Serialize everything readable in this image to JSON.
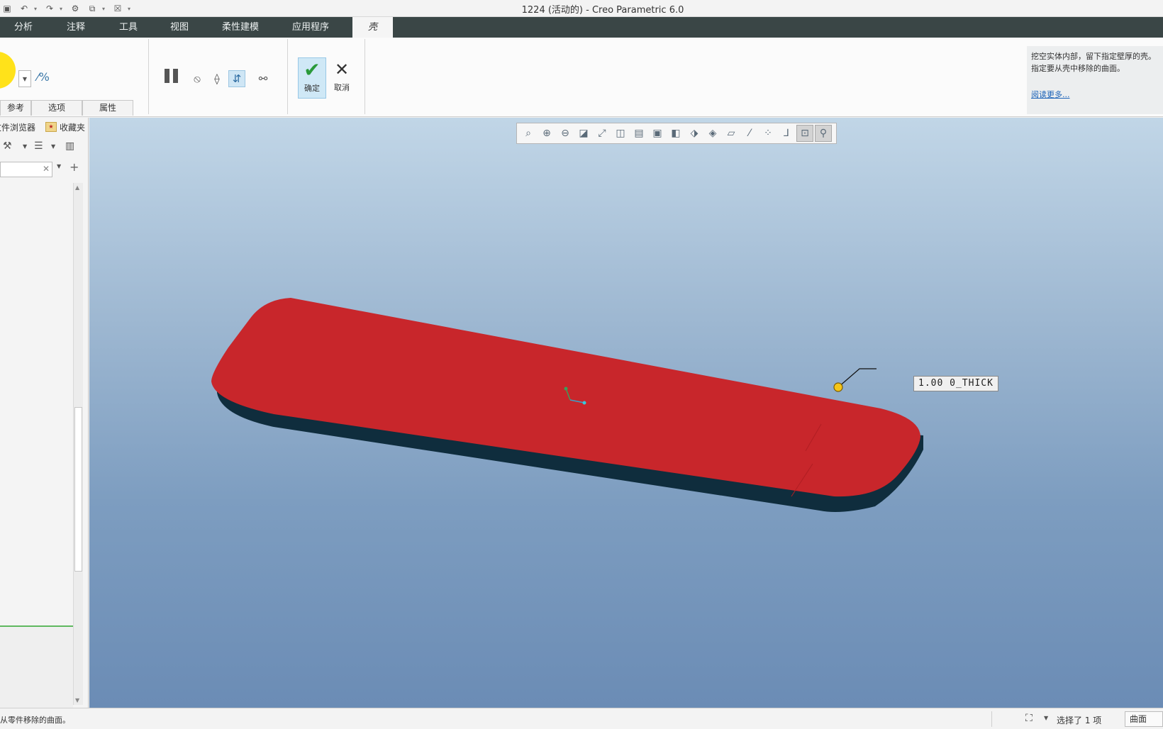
{
  "window": {
    "title": "1224 (活动的) - Creo Parametric 6.0"
  },
  "quick_access": {
    "icons": [
      "save-icon",
      "undo-icon",
      "redo-icon",
      "regenerate-icon",
      "window-icon",
      "close-window-icon",
      "customize-icon"
    ]
  },
  "menu": {
    "tabs": [
      {
        "label": "分析"
      },
      {
        "label": "注释"
      },
      {
        "label": "工具"
      },
      {
        "label": "视图"
      },
      {
        "label": "柔性建模"
      },
      {
        "label": "应用程序"
      },
      {
        "label": "壳"
      }
    ],
    "active": "壳"
  },
  "ribbon": {
    "subtabs": [
      {
        "label": "参考"
      },
      {
        "label": "选项"
      },
      {
        "label": "属性"
      }
    ],
    "ok_label": "确定",
    "cancel_label": "取消",
    "help": {
      "line1": "挖空实体内部，留下指定壁厚的壳。",
      "line2": "指定要从壳中移除的曲面。",
      "link": "阅读更多..."
    }
  },
  "left_panel": {
    "tabs": [
      {
        "label": "文件浏览器"
      },
      {
        "label": "收藏夹"
      }
    ],
    "search": {
      "value": ""
    }
  },
  "graphics": {
    "toolbar_icons": [
      "refit-icon",
      "zoom-in-icon",
      "zoom-out-icon",
      "repaint-icon",
      "spin-center-icon",
      "saved-orientations-icon",
      "named-views-icon",
      "display-style-icon",
      "perspective-icon",
      "section-icon",
      "annotation-display-icon",
      "plane-display-icon",
      "axis-display-icon",
      "point-display-icon",
      "csys-display-icon",
      "spin-center-display-icon",
      "lock-icon"
    ],
    "dimension_label": "1.00 0_THICK",
    "colors": {
      "top_face": "#c8262b",
      "side_face": "#0f2d3d",
      "bg_top": "#c1d6e7",
      "bg_bottom": "#6b8cb5",
      "handle": "#f5c518"
    }
  },
  "status": {
    "message": "从零件移除的曲面。",
    "selection": "选择了 1 项",
    "filter": "曲面"
  }
}
